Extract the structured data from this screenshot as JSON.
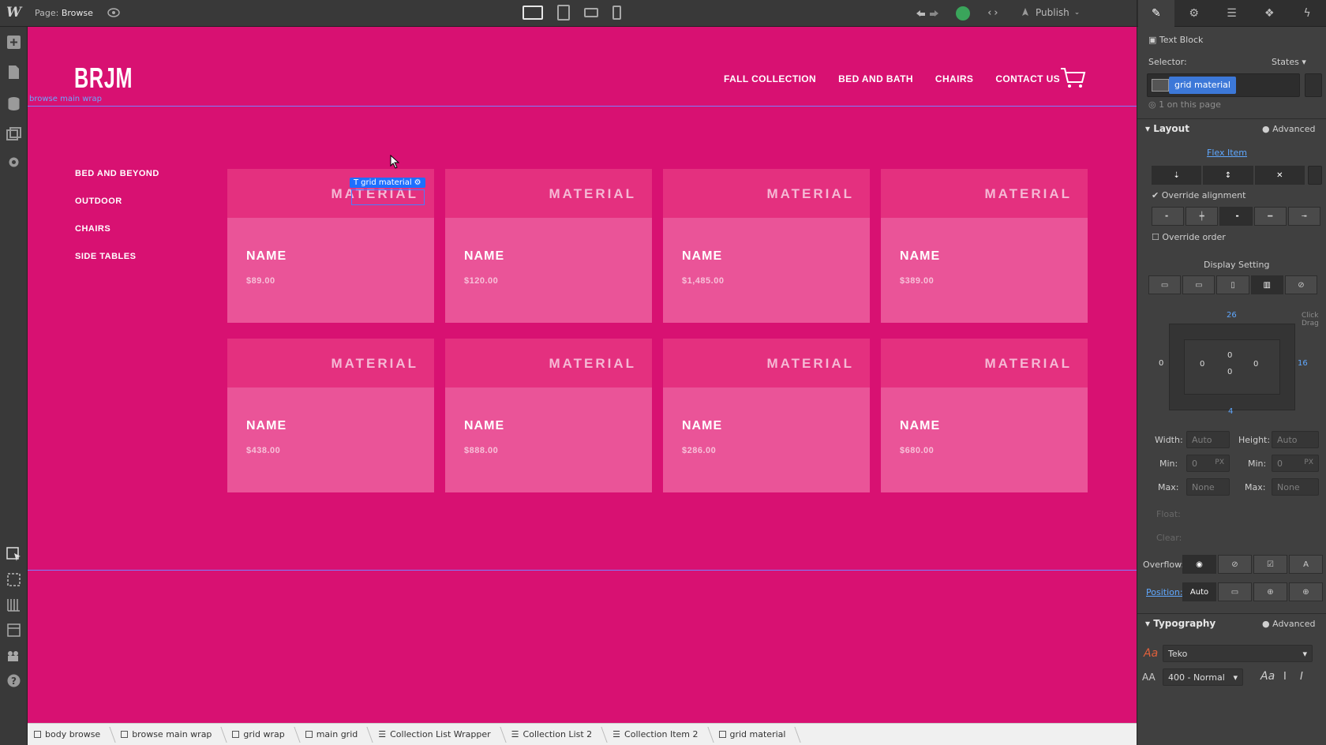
{
  "topbar": {
    "page_prefix": "Page:",
    "page_name": "Browse",
    "publish_label": "Publish"
  },
  "site": {
    "brand": "BRJM",
    "nav": [
      "FALL COLLECTION",
      "BED AND BATH",
      "CHAIRS",
      "CONTACT US"
    ],
    "side_categories": [
      "BED AND BEYOND",
      "OUTDOOR",
      "CHAIRS",
      "SIDE TABLES"
    ],
    "main_wrap_label": "browse main wrap",
    "selected_tag": "grid material",
    "cards": [
      {
        "material": "MATERIAL",
        "name": "NAME",
        "price": "$89.00"
      },
      {
        "material": "MATERIAL",
        "name": "NAME",
        "price": "$120.00"
      },
      {
        "material": "MATERIAL",
        "name": "NAME",
        "price": "$1,485.00"
      },
      {
        "material": "MATERIAL",
        "name": "NAME",
        "price": "$389.00"
      },
      {
        "material": "MATERIAL",
        "name": "NAME",
        "price": "$438.00"
      },
      {
        "material": "MATERIAL",
        "name": "NAME",
        "price": "$888.00"
      },
      {
        "material": "MATERIAL",
        "name": "NAME",
        "price": "$286.00"
      },
      {
        "material": "MATERIAL",
        "name": "NAME",
        "price": "$680.00"
      }
    ]
  },
  "breadcrumb": [
    "body browse",
    "browse main wrap",
    "grid wrap",
    "main grid",
    "Collection List Wrapper",
    "Collection List 2",
    "Collection Item 2",
    "grid material"
  ],
  "panel": {
    "element_type": "Text Block",
    "selector_label": "Selector:",
    "states_label": "States",
    "selector_class": "grid material",
    "on_page": "1 on this page",
    "layout_title": "Layout",
    "advanced": "Advanced",
    "flex_item": "Flex Item",
    "override_alignment": "Override alignment",
    "override_order": "Override order",
    "display_setting": "Display Setting",
    "click_drag": "Click Drag",
    "margin": {
      "top": "26",
      "right": "16",
      "bottom": "4",
      "left": "0"
    },
    "padding": {
      "top": "0",
      "right": "0",
      "bottom": "0",
      "left": "0"
    },
    "width_label": "Width:",
    "height_label": "Height:",
    "min_label": "Min:",
    "max_label": "Max:",
    "auto": "Auto",
    "zero": "0",
    "px": "PX",
    "none": "None",
    "float_label": "Float:",
    "clear_label": "Clear:",
    "overflow_label": "Overflow:",
    "position_label": "Position:",
    "position_value": "Auto",
    "typography_title": "Typography",
    "font_family": "Teko",
    "font_weight": "400 - Normal"
  },
  "colors": {
    "canvas_bg": "#d81172",
    "card_bg": "#ea5498",
    "card_top": "#e4307f",
    "selection": "#1e6fff"
  }
}
